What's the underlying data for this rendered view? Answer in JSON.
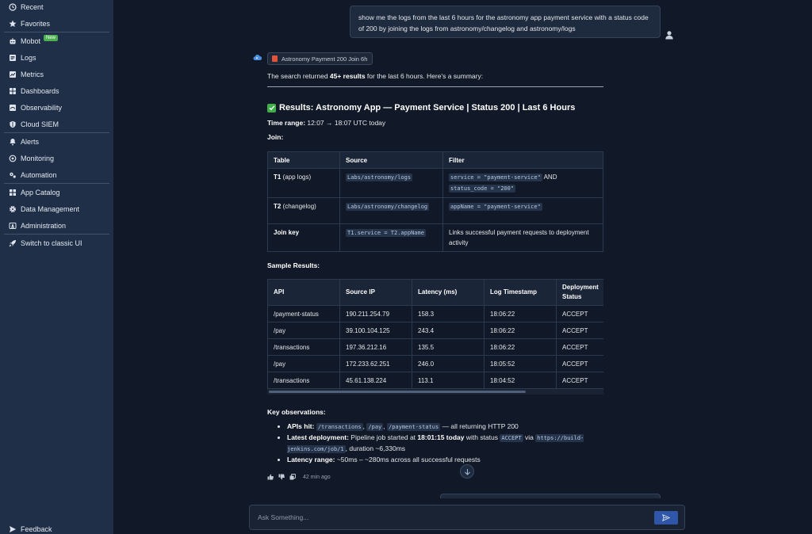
{
  "sidebar": {
    "items": [
      {
        "label": "Recent",
        "icon": "clock-icon"
      },
      {
        "label": "Favorites",
        "icon": "star-icon"
      },
      {
        "label": "Mobot",
        "icon": "robot-icon",
        "badge": "New"
      },
      {
        "label": "Logs",
        "icon": "logs-icon"
      },
      {
        "label": "Metrics",
        "icon": "metrics-icon"
      },
      {
        "label": "Dashboards",
        "icon": "dashboard-icon"
      },
      {
        "label": "Observability",
        "icon": "observability-icon"
      },
      {
        "label": "Cloud SIEM",
        "icon": "shield-icon"
      },
      {
        "label": "Alerts",
        "icon": "bell-icon"
      },
      {
        "label": "Monitoring",
        "icon": "monitoring-icon"
      },
      {
        "label": "Automation",
        "icon": "automation-icon"
      },
      {
        "label": "App Catalog",
        "icon": "grid-icon"
      },
      {
        "label": "Data Management",
        "icon": "gear-icon"
      },
      {
        "label": "Administration",
        "icon": "admin-icon"
      },
      {
        "label": "Switch to classic UI",
        "icon": "rocket-icon"
      }
    ],
    "feedback": "Feedback"
  },
  "chat": {
    "user_message": "show me the logs from the last 6 hours for the astronomy app payment service with a status code of 200 by joining the logs from astronomy/changelog and astronomy/logs",
    "chip_label": "Astronomy Payment 200 Join 6h",
    "summary": {
      "pre": "The search returned ",
      "bold": "45+ results",
      "post": " for the last 6 hours. Here's a summary:"
    },
    "results_title": "Results: Astronomy App — Payment Service | Status 200 | Last 6 Hours",
    "time_range_label": "Time range:",
    "time_range_value": " 12:07 → 18:07 UTC today",
    "join_label": "Join:",
    "join_table": {
      "headers": [
        "Table",
        "Source",
        "Filter"
      ],
      "rows": [
        {
          "table_bold": "T1",
          "table_rest": " (app logs)",
          "source": "Labs/astronomy/logs",
          "filter_code1": "service = \"payment-service\"",
          "filter_mid": " AND ",
          "filter_code2": "status_code = \"200\""
        },
        {
          "table_bold": "T2",
          "table_rest": " (changelog)",
          "source": "Labs/astronomy/changelog",
          "filter_code1": "appName = \"payment-service\""
        },
        {
          "table_bold": "Join key",
          "table_rest": "",
          "source": "T1.service = T2.appName",
          "filter_text": "Links successful payment requests to deployment activity"
        }
      ]
    },
    "sample_label": "Sample Results:",
    "sample_table": {
      "headers": [
        "API",
        "Source IP",
        "Latency (ms)",
        "Log Timestamp",
        "Deployment Status"
      ],
      "rows": [
        [
          "/payment-status",
          "190.211.254.79",
          "158.3",
          "18:06:22",
          "ACCEPT"
        ],
        [
          "/pay",
          "39.100.104.125",
          "243.4",
          "18:06:22",
          "ACCEPT"
        ],
        [
          "/transactions",
          "197.36.212.16",
          "135.5",
          "18:06:22",
          "ACCEPT"
        ],
        [
          "/pay",
          "172.233.62.251",
          "246.0",
          "18:05:52",
          "ACCEPT"
        ],
        [
          "/transactions",
          "45.61.138.224",
          "113.1",
          "18:04:52",
          "ACCEPT"
        ]
      ]
    },
    "key_label": "Key observations:",
    "observations": {
      "apis_label": "APIs hit:",
      "apis_codes": [
        "/transactions",
        "/pay",
        "/payment-status"
      ],
      "apis_sep": ", ",
      "apis_tail": " — all returning HTTP 200",
      "deploy_label": "Latest deployment:",
      "deploy_text1": " Pipeline job started at ",
      "deploy_time": "18:01:15 today",
      "deploy_text2": " with status ",
      "deploy_status": "ACCEPT",
      "deploy_via": " via ",
      "deploy_url": "https://build-jenkins.com/job/1",
      "deploy_tail": ", duration ~6,330ms",
      "latency_label": "Latency range:",
      "latency_text": " ~50ms – ~280ms across all successful requests"
    },
    "timestamp": "42 min ago"
  },
  "input": {
    "placeholder": "Ask Something..."
  },
  "colors": {
    "sidebar_bg": "#1f2f47",
    "main_bg": "#111827",
    "accent": "#2f56a8",
    "badge": "#4caf50"
  }
}
